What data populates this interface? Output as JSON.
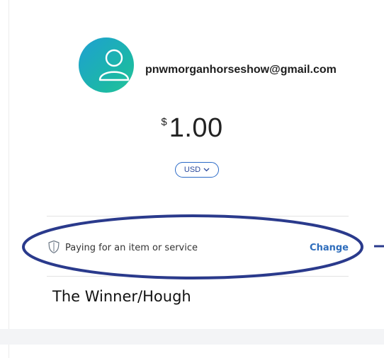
{
  "recipient": {
    "email": "pnwmorganhorseshow@gmail.com",
    "avatar_icon": "user-icon"
  },
  "payment": {
    "currency_symbol": "$",
    "amount": "1.00",
    "currency_code": "USD",
    "currency_dropdown_icon": "chevron-down-icon"
  },
  "payment_type": {
    "label": "Paying for an item or service",
    "icon": "shield-icon",
    "change_label": "Change"
  },
  "note": {
    "text": "The Winner/Hough"
  },
  "colors": {
    "avatar_gradient_start": "#1ea0d2",
    "avatar_gradient_end": "#25c49a",
    "link_blue": "#2e6dbc",
    "annotation_navy": "#2a3a8c"
  }
}
